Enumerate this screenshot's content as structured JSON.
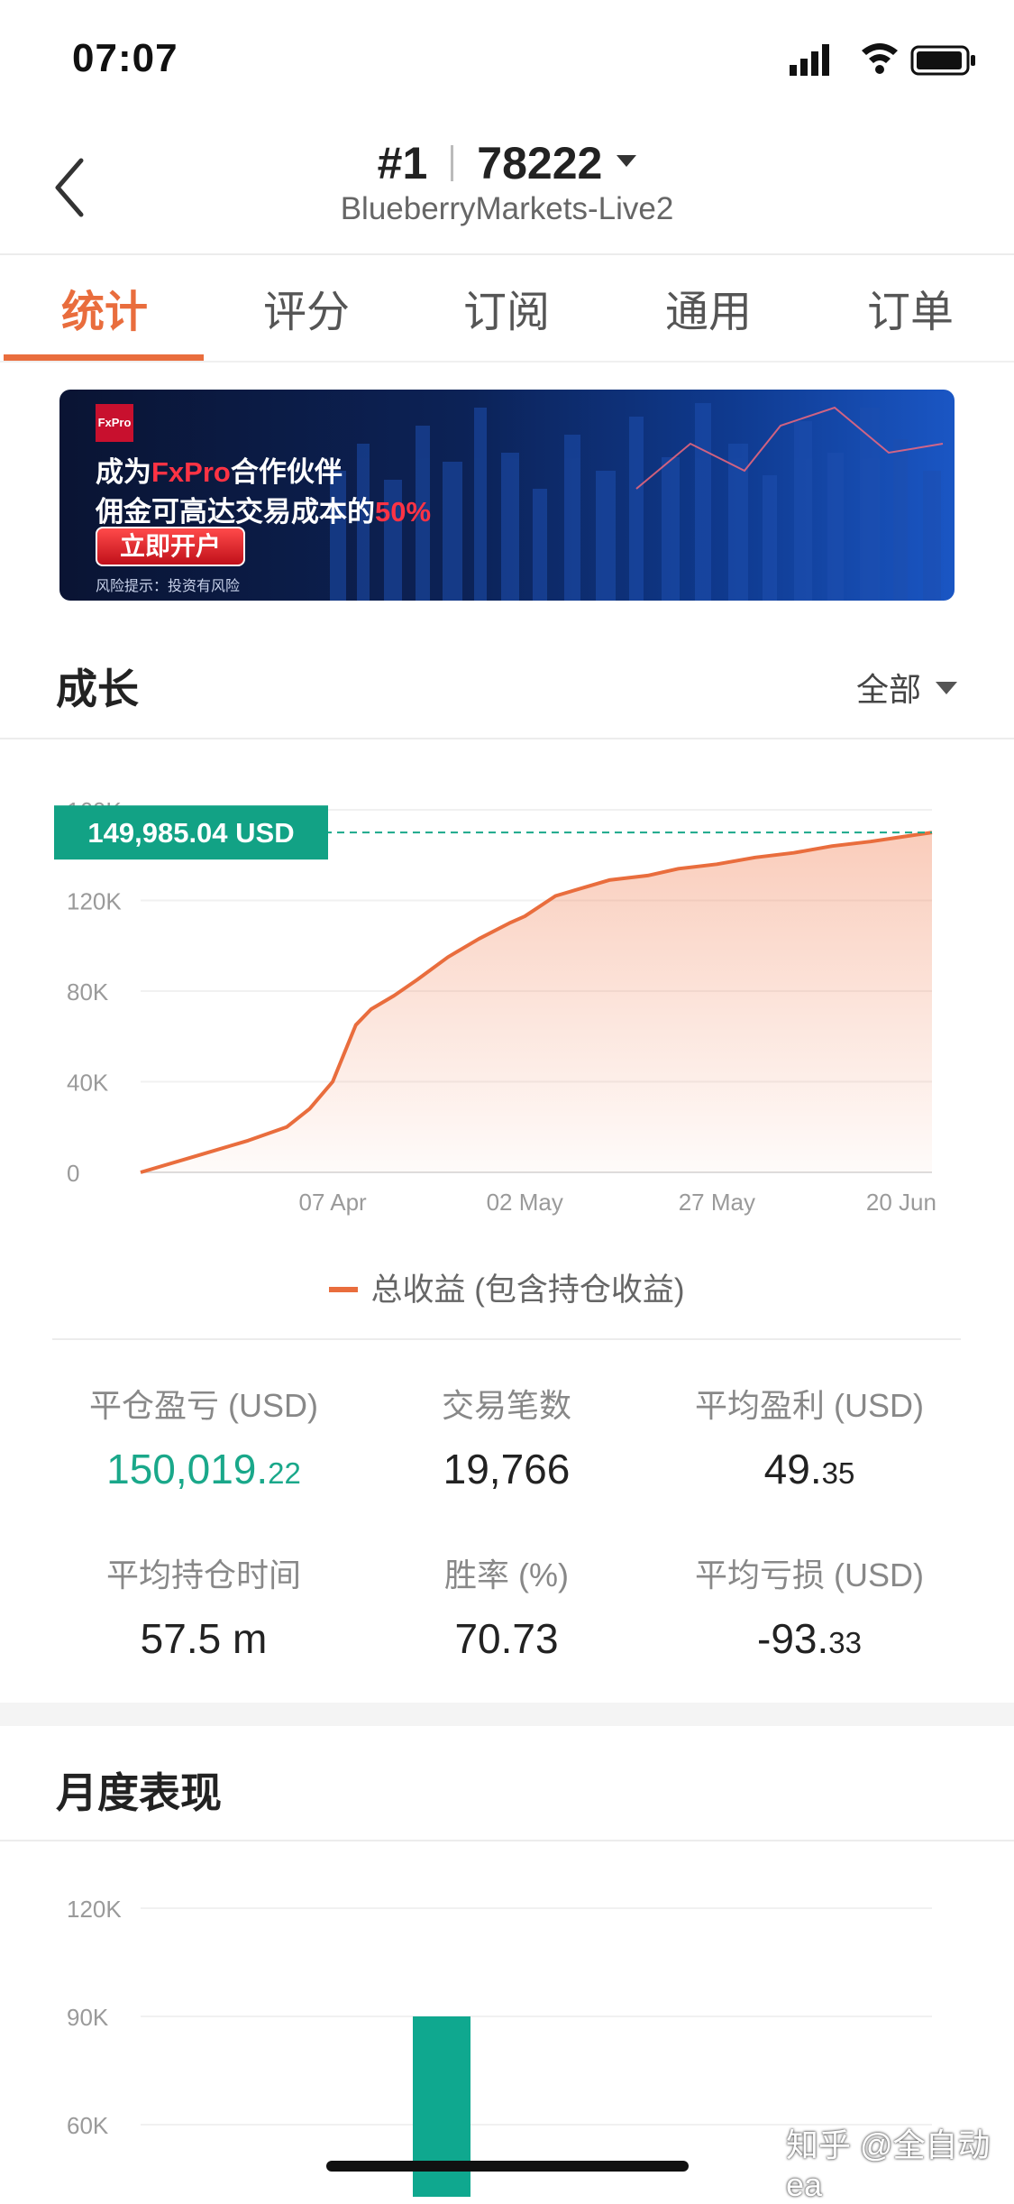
{
  "status_bar": {
    "time": "07:07"
  },
  "header": {
    "account_prefix": "#1",
    "account_number": "78222",
    "server": "BlueberryMarkets-Live2"
  },
  "tabs": [
    {
      "label": "统计",
      "active": true
    },
    {
      "label": "评分",
      "active": false
    },
    {
      "label": "订阅",
      "active": false
    },
    {
      "label": "通用",
      "active": false
    },
    {
      "label": "订单",
      "active": false
    }
  ],
  "banner": {
    "logo": "FxPro",
    "line1_prefix": "成为",
    "line1_brand": "FxPro",
    "line1_suffix": "合作伙伴",
    "line2_prefix": "佣金可高达交易成本的",
    "line2_percent": "50%",
    "cta": "立即开户",
    "risk": "风险提示：投资有风险"
  },
  "growth": {
    "title": "成长",
    "range": "全部",
    "current_value_label": "149,985.04 USD",
    "legend": "总收益 (包含持仓收益)"
  },
  "chart_data": [
    {
      "type": "area",
      "xlabel": "",
      "ylabel": "",
      "y_ticks": [
        "0",
        "40K",
        "80K",
        "120K",
        "160K"
      ],
      "ylim": [
        0,
        160000
      ],
      "x_ticks": [
        "07 Apr",
        "02 May",
        "27 May",
        "20 Jun"
      ],
      "grid": true,
      "series": [
        {
          "name": "总收益 (包含持仓收益)",
          "color": "#e96d3d",
          "x": [
            "2021-03-13",
            "2021-03-20",
            "2021-03-27",
            "2021-04-01",
            "2021-04-04",
            "2021-04-07",
            "2021-04-10",
            "2021-04-12",
            "2021-04-15",
            "2021-04-18",
            "2021-04-22",
            "2021-04-26",
            "2021-04-30",
            "2021-05-02",
            "2021-05-06",
            "2021-05-10",
            "2021-05-13",
            "2021-05-18",
            "2021-05-22",
            "2021-05-27",
            "2021-06-01",
            "2021-06-06",
            "2021-06-11",
            "2021-06-16",
            "2021-06-20",
            "2021-06-24"
          ],
          "values": [
            0,
            7000,
            14000,
            20000,
            28000,
            40000,
            65000,
            72000,
            78000,
            85000,
            95000,
            103000,
            110000,
            113000,
            122000,
            126000,
            129000,
            131000,
            134000,
            136000,
            139000,
            141000,
            144000,
            146000,
            148000,
            149985
          ]
        }
      ]
    },
    {
      "type": "bar",
      "title": "月度表现",
      "y_ticks": [
        "60K",
        "90K",
        "120K"
      ],
      "ylim": [
        50000,
        120000
      ],
      "grid": true,
      "color": "#0fa88f",
      "series": [
        {
          "name": "",
          "values": [
            90000
          ]
        }
      ]
    }
  ],
  "stats": [
    {
      "label": "平仓盈亏 (USD)",
      "int": "150,019.",
      "dec": "22",
      "green": true
    },
    {
      "label": "交易笔数",
      "int": "19,766",
      "dec": "",
      "green": false
    },
    {
      "label": "平均盈利 (USD)",
      "int": "49.",
      "dec": "35",
      "green": false
    },
    {
      "label": "平均持仓时间",
      "int": "57.5 m",
      "dec": "",
      "green": false
    },
    {
      "label": "胜率 (%)",
      "int": "70.73",
      "dec": "",
      "green": false
    },
    {
      "label": "平均亏损 (USD)",
      "int": "-93.",
      "dec": "33",
      "green": false
    }
  ],
  "monthly": {
    "title": "月度表现"
  },
  "watermark": "知乎 @全自动ea"
}
